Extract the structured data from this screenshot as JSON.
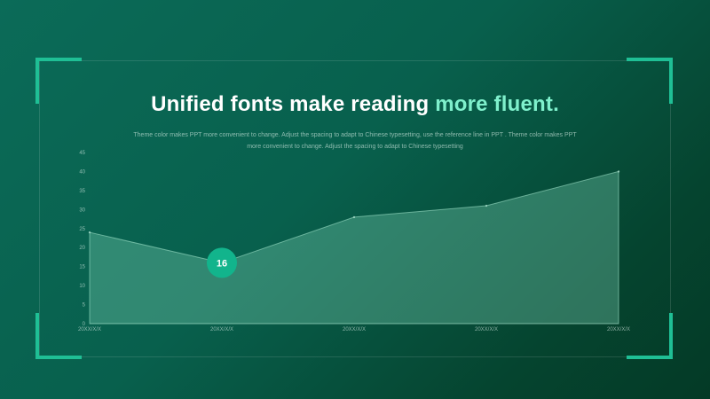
{
  "slide": {
    "title_main": "Unified fonts make reading ",
    "title_accent": "more fluent.",
    "subtitle": "Theme color makes PPT more convenient to change. Adjust the spacing to adapt to Chinese typesetting, use the reference line in PPT . Theme color makes PPT more convenient to change. Adjust the spacing to adapt to Chinese typesetting"
  },
  "colors": {
    "accent": "#1fbf95",
    "title_accent": "#7ff0cc",
    "marker": "#12b48c"
  },
  "chart_data": {
    "type": "area",
    "categories": [
      "20XX/X/X",
      "20XX/X/X",
      "20XX/X/X",
      "20XX/X/X",
      "20XX/X/X"
    ],
    "series": [
      {
        "values": [
          24,
          16,
          28,
          31,
          40
        ]
      }
    ],
    "ylim": [
      0,
      45
    ],
    "yticks": [
      0,
      5,
      10,
      15,
      20,
      25,
      30,
      35,
      40,
      45
    ],
    "highlight": {
      "index": 1,
      "label": "16"
    },
    "grid": false,
    "legend": "none"
  }
}
